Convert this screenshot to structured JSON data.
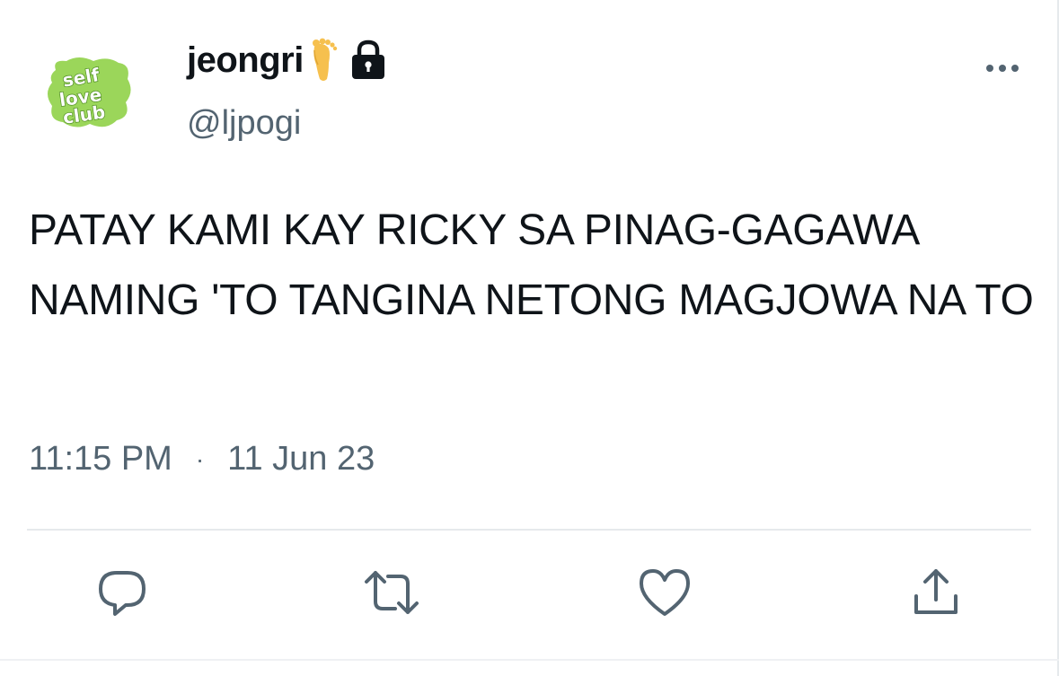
{
  "user": {
    "display_name": "jeongri",
    "handle": "@ljpogi",
    "avatar_text": "self love club",
    "name_emoji": "foot",
    "protected_icon": "lock-icon"
  },
  "tweet": {
    "text": "PATAY KAMI KAY RICKY SA PINAG-GAGAWA NAMING 'TO TANGINA NETONG MAGJOWA NA TO",
    "time": "11:15 PM",
    "separator": "·",
    "date": "11 Jun 23"
  },
  "actions": [
    {
      "name": "reply",
      "icon": "reply-icon"
    },
    {
      "name": "retweet",
      "icon": "retweet-icon"
    },
    {
      "name": "like",
      "icon": "heart-icon"
    },
    {
      "name": "share",
      "icon": "share-icon"
    }
  ],
  "colors": {
    "text": "#0f1419",
    "secondary": "#536471",
    "divider": "#e6e9ec",
    "avatar_green": "#9bd65a",
    "avatar_dark": "#6fb33a"
  }
}
